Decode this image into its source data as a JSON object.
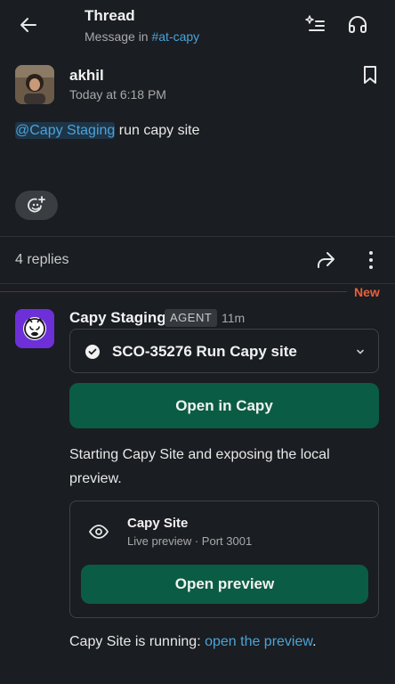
{
  "header": {
    "title": "Thread",
    "subtitle_prefix": "Message in ",
    "channel": "#at-capy"
  },
  "post": {
    "author": "akhil",
    "time": "Today at 6:18 PM",
    "mention": "@Capy Staging",
    "text": " run capy site"
  },
  "replies": {
    "count_label": "4 replies",
    "new_label": "New"
  },
  "reply": {
    "author": "Capy Staging",
    "badge": "AGENT",
    "time": "11m",
    "task_title": "SCO-35276 Run Capy site",
    "open_button": "Open in Capy",
    "status_text": "Starting Capy Site and exposing the local preview.",
    "site_card": {
      "title": "Capy Site",
      "subtitle": "Live preview · Port 3001",
      "button": "Open preview"
    },
    "final_prefix": "Capy Site is running: ",
    "final_link": "open the preview",
    "final_suffix": "."
  },
  "colors": {
    "background": "#1a1d21",
    "link": "#4ba3d9",
    "button_green": "#0b5c44",
    "new_marker": "#e8603c",
    "bot_avatar": "#6d2fd8"
  },
  "icons": [
    "back-arrow-icon",
    "ai-sparkle-list-icon",
    "headphones-icon",
    "bookmark-icon",
    "add-reaction-icon",
    "share-icon",
    "more-vertical-icon",
    "check-circle-icon",
    "chevron-down-icon",
    "eye-icon",
    "capy-logo-icon"
  ]
}
